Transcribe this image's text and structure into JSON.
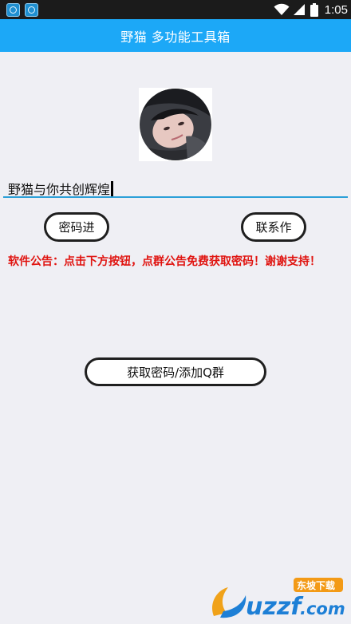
{
  "status_bar": {
    "time": "1:05",
    "notification_icons": [
      "app-notification-icon",
      "app-notification-icon"
    ],
    "icons": [
      "wifi-icon",
      "signal-icon",
      "battery-icon"
    ]
  },
  "app_bar": {
    "title": "野猫 多功能工具箱"
  },
  "avatar": {
    "icon": "profile-photo"
  },
  "motto": {
    "value": "野猫与你共创辉煌"
  },
  "buttons": {
    "password": "密码进",
    "contact": "联系作",
    "get_password": "获取密码/添加Q群"
  },
  "notice": {
    "text": "软件公告：点击下方按钮，点群公告免费获取密码！谢谢支持！",
    "color": "#e0130f"
  },
  "colors": {
    "accent": "#1ca8f7",
    "underline": "#2b9fd8",
    "background": "#efeff4"
  },
  "watermark": {
    "logo_text": "uzzf.com",
    "badge_text": "东坡下载"
  }
}
